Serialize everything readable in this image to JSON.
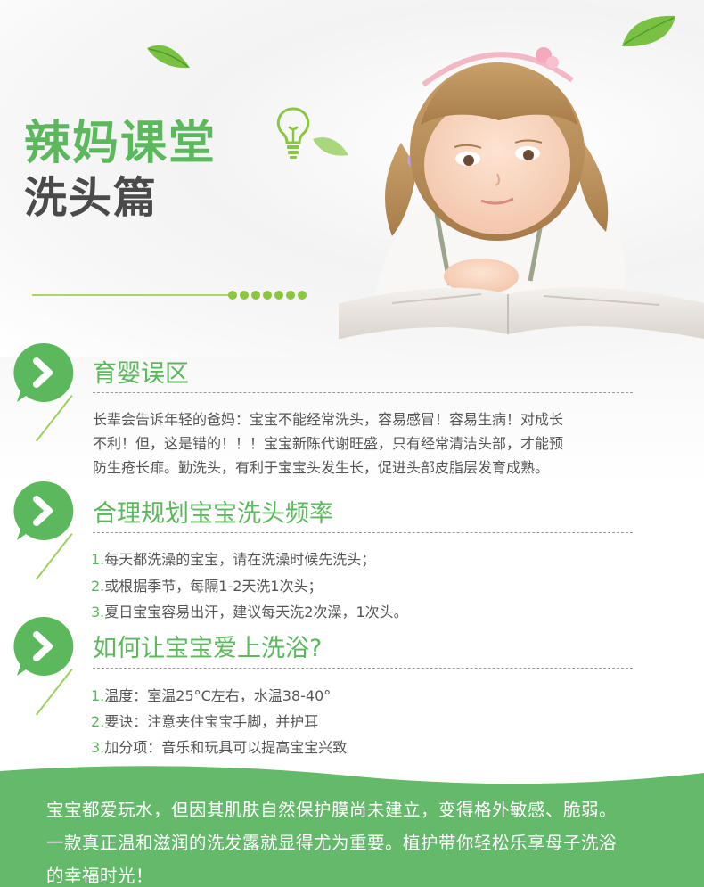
{
  "header": {
    "title": "辣妈课堂",
    "subtitle": "洗头篇"
  },
  "colors": {
    "accent_green": "#5cb85c",
    "band_green": "#65b96a",
    "leaf_green": "#7ac143"
  },
  "sections": [
    {
      "title": "育婴误区",
      "paragraph": [
        "长辈会告诉年轻的爸妈：宝宝不能经常洗头，容易感冒！容易生病！对成长",
        "不利！但，这是错的！！！宝宝新陈代谢旺盛，只有经常清洁头部，才能预",
        "防生疮长痱。勤洗头，有利于宝宝头发生长，促进头部皮脂层发育成熟。"
      ]
    },
    {
      "title": "合理规划宝宝洗头频率",
      "items": [
        {
          "num": "1.",
          "text": "每天都洗澡的宝宝，请在洗澡时候先洗头；"
        },
        {
          "num": "2.",
          "text": "或根据季节，每隔1-2天洗1次头；"
        },
        {
          "num": "3.",
          "text": "夏日宝宝容易出汗，建议每天洗2次澡，1次头。"
        }
      ]
    },
    {
      "title": "如何让宝宝爱上洗浴?",
      "items": [
        {
          "num": "1.",
          "text": "温度：室温25°C左右，水温38-40°"
        },
        {
          "num": "2.",
          "text": "要诀：注意夹住宝宝手脚，并护耳"
        },
        {
          "num": "3.",
          "text": "加分项：音乐和玩具可以提高宝宝兴致"
        }
      ]
    }
  ],
  "footer": {
    "lines": [
      "宝宝都爱玩水，但因其肌肤自然保护膜尚未建立，变得格外敏感、脆弱。",
      "一款真正温和滋润的洗发露就显得尤为重要。植护带你轻松乐享母子洗浴",
      "的幸福时光！"
    ]
  }
}
